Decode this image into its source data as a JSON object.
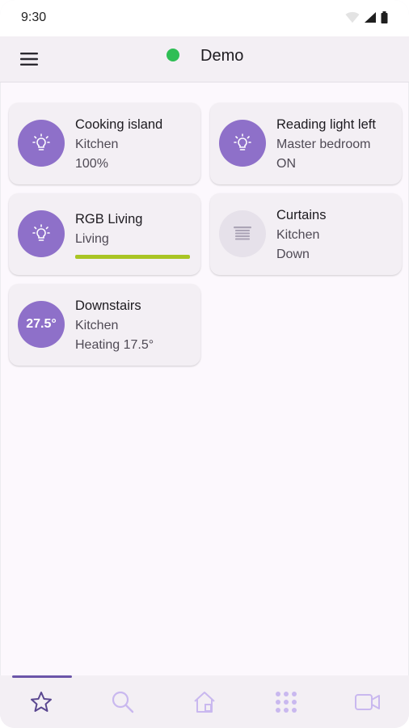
{
  "status_bar": {
    "time": "9:30"
  },
  "app_bar": {
    "title": "Demo",
    "connection_color": "#2fbe55"
  },
  "colors": {
    "accent": "#8e70c9",
    "slider": "#a9c524",
    "nav_active": "#6b55a9",
    "nav_inactive": "#c9b8ef"
  },
  "cards": [
    {
      "title": "Cooking island",
      "room": "Kitchen",
      "state": "100%",
      "icon": "lightbulb-icon"
    },
    {
      "title": "Reading light left",
      "room": "Master bedroom",
      "state": "ON",
      "icon": "lightbulb-icon"
    },
    {
      "title": "RGB Living",
      "room": "Living",
      "icon": "lightbulb-icon",
      "level_fraction": 1.0
    },
    {
      "title": "Curtains",
      "room": "Kitchen",
      "state": "Down",
      "icon": "blinds-icon"
    },
    {
      "title": "Downstairs",
      "room": "Kitchen",
      "state": "Heating 17.5°",
      "temperature": "27.5°",
      "icon": "thermostat"
    }
  ],
  "bottom_nav": [
    {
      "icon": "star-icon",
      "active": true
    },
    {
      "icon": "search-icon",
      "active": false
    },
    {
      "icon": "home-icon",
      "active": false
    },
    {
      "icon": "grid-icon",
      "active": false
    },
    {
      "icon": "video-camera-icon",
      "active": false
    }
  ]
}
